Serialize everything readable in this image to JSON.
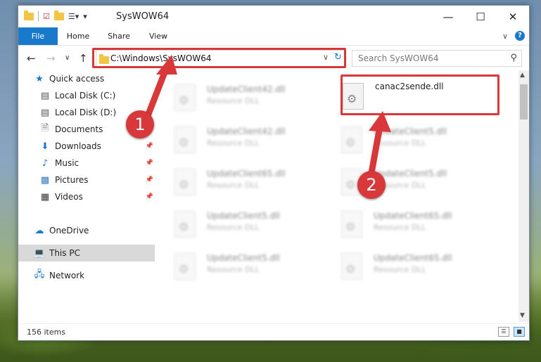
{
  "window": {
    "title": "SysWOW64",
    "minimize_glyph": "—",
    "maximize_glyph": "☐",
    "close_glyph": "✕"
  },
  "ribbon": {
    "tabs": [
      "File",
      "Home",
      "Share",
      "View"
    ],
    "help": "?"
  },
  "address": {
    "path": "C:\\Windows\\SysWOW64",
    "search_placeholder": "Search SysWOW64"
  },
  "sidebar": {
    "items": [
      {
        "label": "Quick access",
        "icon": "star-icon"
      },
      {
        "label": "Local Disk (C:)",
        "icon": "drive-icon"
      },
      {
        "label": "Local Disk (D:)",
        "icon": "drive-icon"
      },
      {
        "label": "Documents",
        "icon": "documents-icon"
      },
      {
        "label": "Downloads",
        "icon": "downloads-icon"
      },
      {
        "label": "Music",
        "icon": "music-icon"
      },
      {
        "label": "Pictures",
        "icon": "pictures-icon"
      },
      {
        "label": "Videos",
        "icon": "videos-icon"
      },
      {
        "label": "OneDrive",
        "icon": "cloud-icon"
      },
      {
        "label": "This PC",
        "icon": "computer-icon"
      },
      {
        "label": "Network",
        "icon": "network-icon"
      }
    ]
  },
  "files": [
    {
      "name": "UpdateClient42.dll",
      "type": "Resource DLL"
    },
    {
      "name": "canac2sende.dll",
      "type": ""
    },
    {
      "name": "UpdateClient42.dll",
      "type": "Resource DLL"
    },
    {
      "name": "UpdateClient5.dll",
      "type": "Resource DLL"
    },
    {
      "name": "UpdateClient65.dll",
      "type": "Resource DLL"
    },
    {
      "name": "UpdateClient5.dll",
      "type": "Resource DLL"
    },
    {
      "name": "UpdateClient5.dll",
      "type": "Resource DLL"
    },
    {
      "name": "UpdateClient65.dll",
      "type": "Resource DLL"
    },
    {
      "name": "UpdateClient5.dll",
      "type": "Resource DLL"
    },
    {
      "name": "UpdateClient65.dll",
      "type": "Resource DLL"
    }
  ],
  "status": {
    "item_count": "156 items"
  },
  "callouts": [
    "1",
    "2"
  ],
  "colors": {
    "accent": "#1979ca",
    "highlight": "#d9383a"
  }
}
